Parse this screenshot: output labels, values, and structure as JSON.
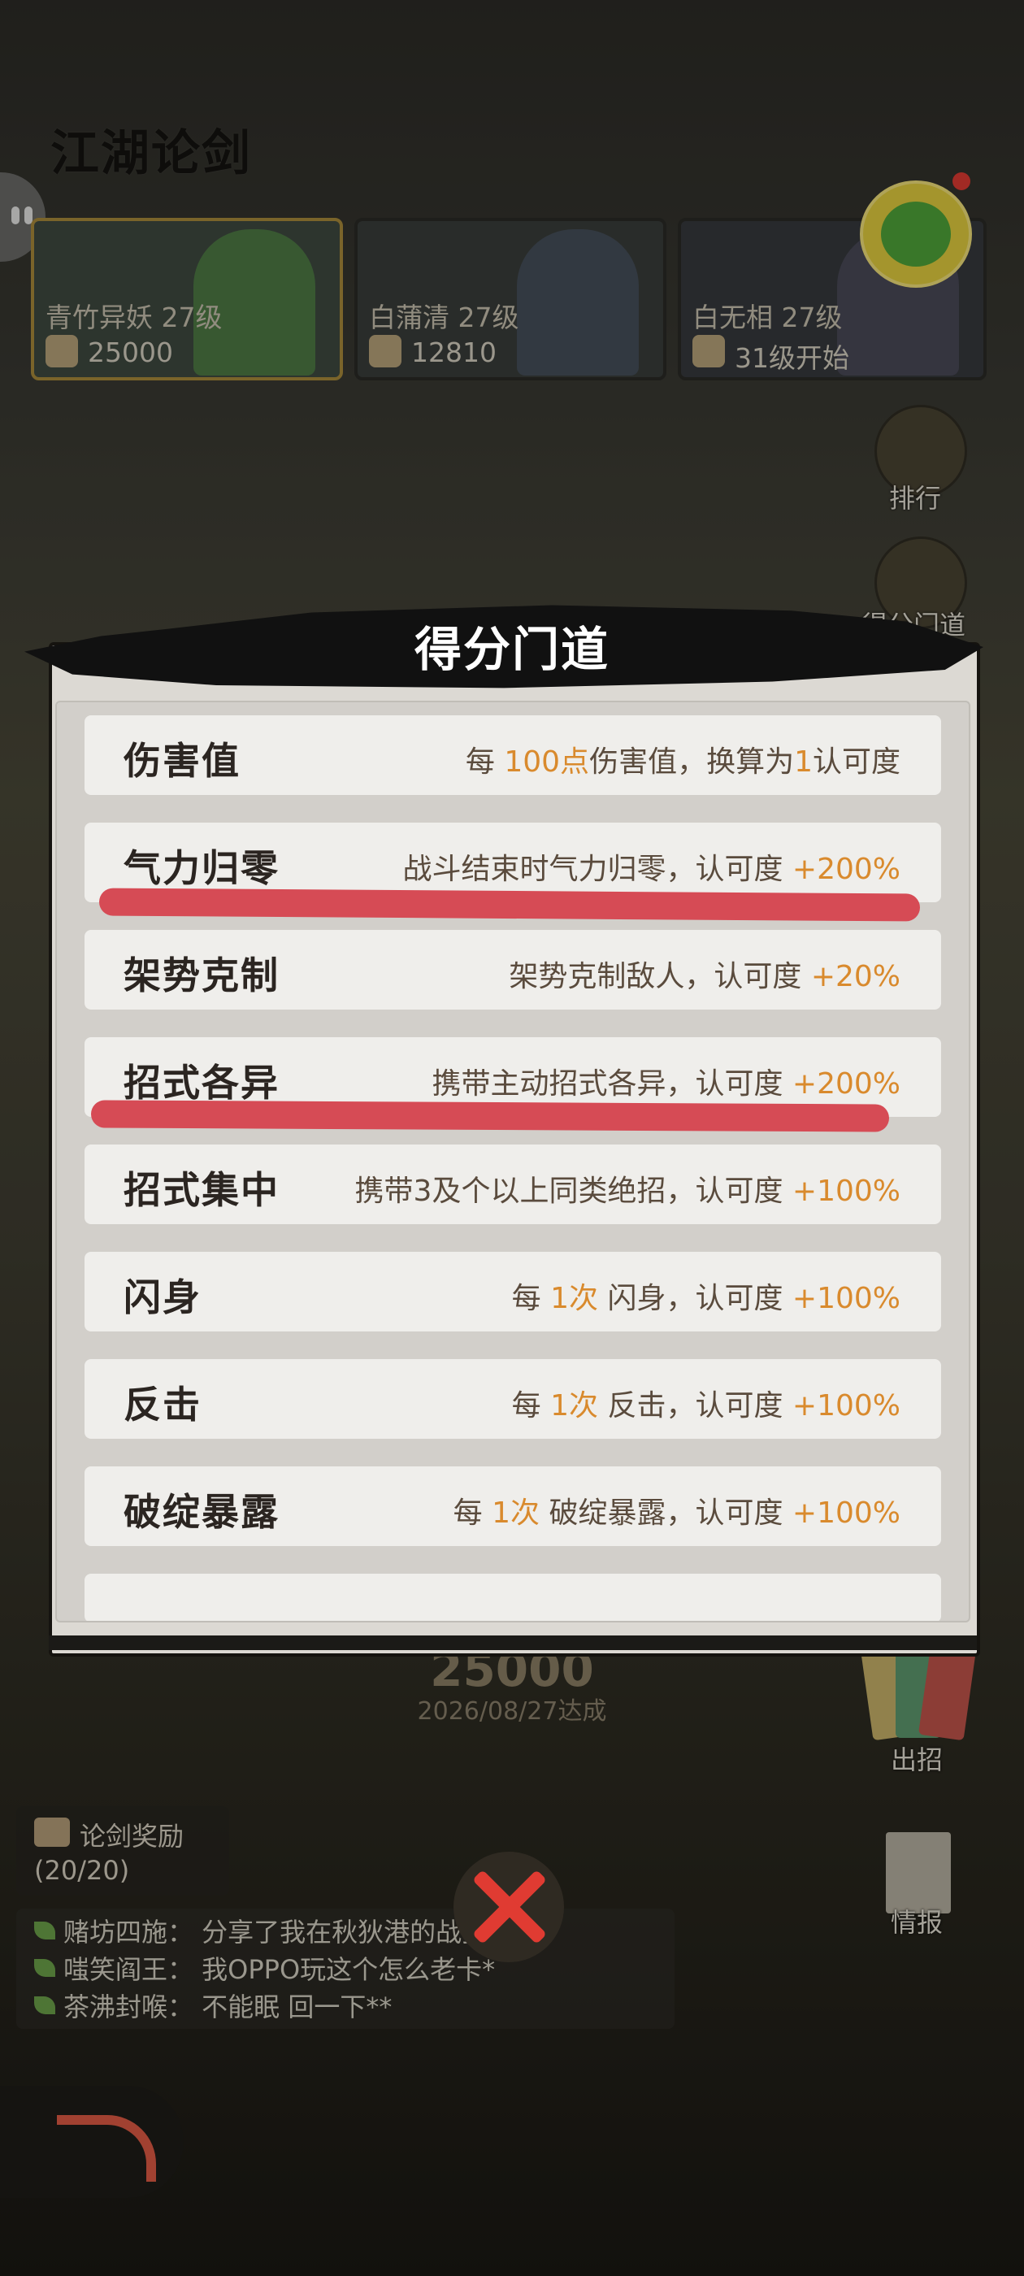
{
  "background": {
    "title": "江湖论剑",
    "bosses": [
      {
        "name": "青竹异妖 27级",
        "value": "25000"
      },
      {
        "name": "白蒲清 27级",
        "value": "12810"
      },
      {
        "name": "白无相 27级",
        "value": "31级开始"
      }
    ],
    "right_buttons": [
      "排行",
      "得分门道",
      "出招",
      "情报"
    ],
    "score": "25000",
    "date": "2026/08/27达成",
    "reward": {
      "label": "论剑奖励",
      "count": "(20/20)"
    },
    "chat": [
      "赌坊四施： 分享了我在秋狄港的战招…",
      "嗤笑阎王： 我OPPO玩这个怎么老卡*",
      "茶沸封喉： 不能眠 回一下**"
    ]
  },
  "modal": {
    "title": "得分门道",
    "rows": [
      {
        "label": "伤害值",
        "desc": [
          [
            "",
            "每 "
          ],
          [
            "o",
            "100点"
          ],
          [
            "",
            "伤害值，换算为"
          ],
          [
            "o",
            "1"
          ],
          [
            "",
            "认可度"
          ]
        ]
      },
      {
        "label": "气力归零",
        "desc": [
          [
            "",
            "战斗结束时气力归零，认可度 "
          ],
          [
            "o",
            "+200%"
          ]
        ]
      },
      {
        "label": "架势克制",
        "desc": [
          [
            "",
            "架势克制敌人，认可度 "
          ],
          [
            "o",
            "+20%"
          ]
        ]
      },
      {
        "label": "招式各异",
        "desc": [
          [
            "",
            "携带主动招式各异，认可度 "
          ],
          [
            "o",
            "+200%"
          ]
        ]
      },
      {
        "label": "招式集中",
        "desc": [
          [
            "",
            "携带3及个以上同类绝招，认可度 "
          ],
          [
            "o",
            "+100%"
          ]
        ]
      },
      {
        "label": "闪身",
        "desc": [
          [
            "",
            "每 "
          ],
          [
            "o",
            "1次"
          ],
          [
            "",
            " 闪身，认可度 "
          ],
          [
            "o",
            "+100%"
          ]
        ]
      },
      {
        "label": "反击",
        "desc": [
          [
            "",
            "每 "
          ],
          [
            "o",
            "1次"
          ],
          [
            "",
            " 反击，认可度 "
          ],
          [
            "o",
            "+100%"
          ]
        ]
      },
      {
        "label": "破绽暴露",
        "desc": [
          [
            "",
            "每 "
          ],
          [
            "o",
            "1次"
          ],
          [
            "",
            " 破绽暴露，认可度 "
          ],
          [
            "o",
            "+100%"
          ]
        ]
      }
    ]
  },
  "colors": {
    "accent": "#d98a2d",
    "highlight_stroke": "#d64b55",
    "close_x": "#e03b32"
  }
}
